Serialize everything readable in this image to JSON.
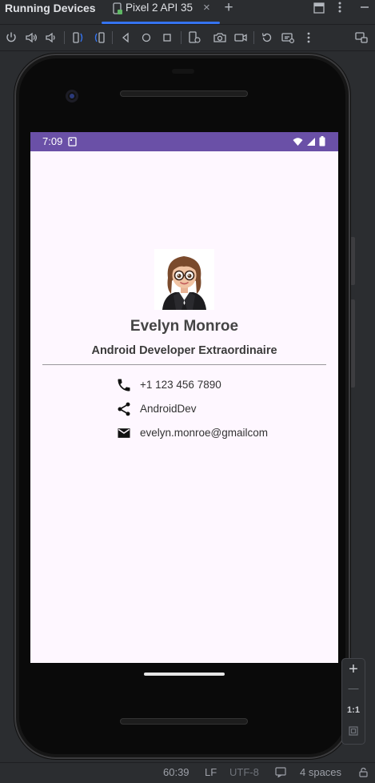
{
  "title_bar": {
    "title": "Running Devices",
    "tab_label": "Pixel 2 API 35",
    "tab_close": "×",
    "add_tab": "+"
  },
  "toolbar": {
    "icons": [
      "power-icon",
      "volume-up-icon",
      "volume-down-icon",
      "rotate-left-icon",
      "rotate-right-icon",
      "back-icon",
      "home-icon",
      "overview-icon",
      "device-state-icon",
      "screenshot-icon",
      "screen-record-icon",
      "reset-icon",
      "snapshot-icon",
      "more-icon",
      "mirror-icon"
    ]
  },
  "device": {
    "status_time": "7:09",
    "profile": {
      "name": "Evelyn Monroe",
      "title": "Android Developer Extraordinaire"
    },
    "contacts": [
      {
        "icon": "phone-icon",
        "text": "+1 123 456 7890"
      },
      {
        "icon": "share-icon",
        "text": "AndroidDev"
      },
      {
        "icon": "email-icon",
        "text": "evelyn.monroe@gmailcom"
      }
    ]
  },
  "zoom": {
    "plus": "+",
    "minus": "—",
    "one_to_one": "1:1"
  },
  "status_line": {
    "position": "60:39",
    "line_ending": "LF",
    "encoding": "UTF-8",
    "indent": "4 spaces"
  },
  "colors": {
    "accent": "#3574f0",
    "statusbar": "#6a50a7",
    "screen_bg": "#fef7ff"
  }
}
